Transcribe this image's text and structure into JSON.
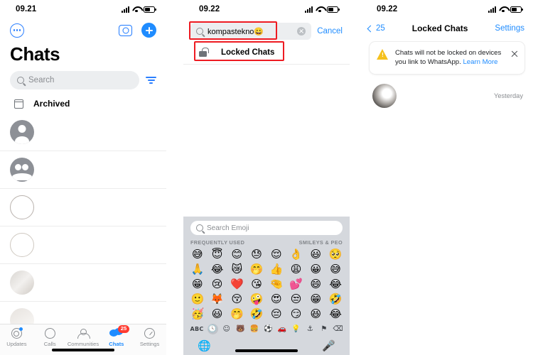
{
  "panel1": {
    "status": {
      "time": "09.21",
      "signal_icon": "signal-bars-icon",
      "wifi_icon": "wifi-icon",
      "battery_icon": "battery-icon"
    },
    "menu_icon": "more-options-icon",
    "camera_icon": "camera-icon",
    "new_chat_icon": "new-chat-plus-icon",
    "title": "Chats",
    "search": {
      "placeholder": "Search",
      "icon": "search-icon",
      "filter_icon": "filter-icon"
    },
    "archived": {
      "label": "Archived",
      "icon": "archive-box-icon"
    },
    "chat_rows": [
      {
        "avatar": "person-avatar",
        "name": "",
        "preview": ""
      },
      {
        "avatar": "group-avatar",
        "name": "",
        "preview": ""
      },
      {
        "avatar": "ring-avatar",
        "name": "",
        "preview": ""
      },
      {
        "avatar": "ring-avatar-2",
        "name": "",
        "preview": ""
      },
      {
        "avatar": "blurred-avatar",
        "name": "",
        "preview": ""
      },
      {
        "avatar": "blurred-avatar-2",
        "name": "",
        "preview": ""
      }
    ],
    "tabs": [
      {
        "label": "Updates",
        "icon": "updates-icon",
        "active": false,
        "badge": ""
      },
      {
        "label": "Calls",
        "icon": "calls-icon",
        "active": false,
        "badge": ""
      },
      {
        "label": "Communities",
        "icon": "communities-icon",
        "active": false,
        "badge": ""
      },
      {
        "label": "Chats",
        "icon": "chats-icon",
        "active": true,
        "badge": "25"
      },
      {
        "label": "Settings",
        "icon": "settings-icon",
        "active": false,
        "badge": ""
      }
    ]
  },
  "panel2": {
    "status": {
      "time": "09.22"
    },
    "search": {
      "value": "kompastekno😀",
      "icon": "search-icon",
      "clear_icon": "clear-text-icon"
    },
    "cancel_label": "Cancel",
    "result": {
      "label": "Locked Chats",
      "icon": "unlocked-padlock-icon"
    },
    "keyboard": {
      "emoji_search_placeholder": "Search Emoji",
      "section_left": "FREQUENTLY USED",
      "section_right": "SMILEYS & PEO",
      "emoji_rows": [
        [
          "😅",
          "😇",
          "😊",
          "😓",
          "😌",
          "👌",
          "😃",
          "🥺"
        ],
        [
          "🙏",
          "😂",
          "😿",
          "🤭",
          "👍",
          "😩",
          "😀",
          "😅"
        ],
        [
          "😁",
          "😢",
          "❤️",
          "😘",
          "🤏",
          "💕",
          "😄",
          "😂"
        ],
        [
          "🙂",
          "🦊",
          "😚",
          "🤪",
          "😍",
          "😒",
          "😁",
          "🤣"
        ],
        [
          "🥳",
          "😃",
          "🤭",
          "🤣",
          "😔",
          "😏",
          "😆",
          "😂"
        ]
      ],
      "categories": [
        "ABC",
        "🕓",
        "☺",
        "🐻",
        "🍔",
        "⚽",
        "🚗",
        "💡",
        "⚓",
        "⚑",
        "⌫"
      ],
      "selected_category_index": 1,
      "globe_icon": "globe-keyboard-icon",
      "mic_icon": "microphone-icon"
    }
  },
  "panel3": {
    "status": {
      "time": "09.22"
    },
    "back_label": "25",
    "title": "Locked Chats",
    "settings_label": "Settings",
    "banner": {
      "text": "Chats will not be locked on devices you link to WhatsApp. ",
      "link_label": "Learn More",
      "warning_icon": "warning-triangle-icon",
      "close_icon": "close-icon"
    },
    "chat": {
      "avatar": "blurred-contact-avatar",
      "timestamp": "Yesterday"
    }
  },
  "colors": {
    "accent_blue": "#1f8cff",
    "badge_red": "#ff3b30",
    "highlight_red": "#ee1b22",
    "warning_yellow": "#f5c11e",
    "keyboard_gray": "#d5d8dd"
  }
}
